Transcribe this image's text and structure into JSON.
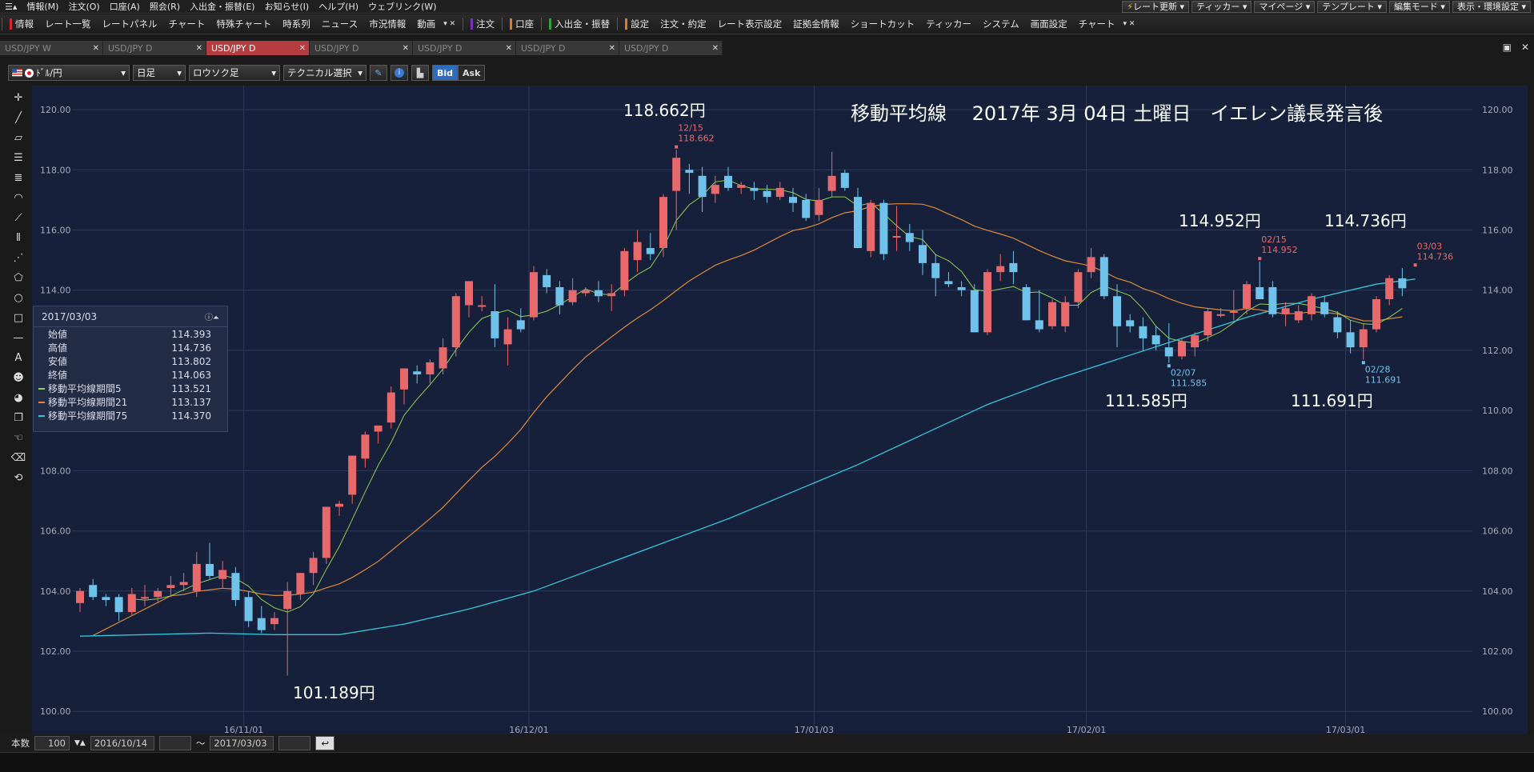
{
  "menubar": {
    "items": [
      "情報(M)",
      "注文(O)",
      "口座(A)",
      "照会(R)",
      "入出金・振替(E)",
      "お知らせ(I)",
      "ヘルプ(H)",
      "ウェブリンク(W)"
    ],
    "right_buttons": [
      "レート更新",
      "ティッカー",
      "マイページ",
      "テンプレート",
      "編集モード",
      "表示・環境設定"
    ]
  },
  "toolbar": {
    "items": [
      {
        "label": "情報",
        "color": "#d9252a"
      },
      {
        "label": "レート一覧"
      },
      {
        "label": "レートパネル"
      },
      {
        "label": "チャート"
      },
      {
        "label": "特殊チャート"
      },
      {
        "label": "時系列"
      },
      {
        "label": "ニュース"
      },
      {
        "label": "市況情報"
      },
      {
        "label": "動画"
      },
      {
        "label": "注文",
        "color": "#7b2fbe"
      },
      {
        "label": "口座",
        "color": "#e07a1f"
      },
      {
        "label": "入出金・振替",
        "color": "#2aa33a"
      },
      {
        "label": "設定",
        "color": "#e07a1f"
      },
      {
        "label": "注文・約定"
      },
      {
        "label": "レート表示設定"
      },
      {
        "label": "証拠金情報"
      },
      {
        "label": "ショートカット"
      },
      {
        "label": "ティッカー"
      },
      {
        "label": "システム"
      },
      {
        "label": "画面設定"
      },
      {
        "label": "チャート"
      }
    ]
  },
  "tabs": [
    {
      "label": "USD/JPY W",
      "active": false
    },
    {
      "label": "USD/JPY D",
      "active": false
    },
    {
      "label": "USD/JPY D",
      "active": true
    },
    {
      "label": "USD/JPY D",
      "active": false
    },
    {
      "label": "USD/JPY D",
      "active": false
    },
    {
      "label": "USD/JPY D",
      "active": false
    },
    {
      "label": "USD/JPY D",
      "active": false
    }
  ],
  "chart_toolbar": {
    "pair": "ﾄﾞﾙ/円",
    "timeframe": "日足",
    "chart_style": "ロウソク足",
    "technical": "テクニカル選択",
    "bid": "Bid",
    "ask": "Ask"
  },
  "infobox": {
    "date": "2017/03/03",
    "rows": [
      {
        "label": "始値",
        "value": "114.393"
      },
      {
        "label": "高値",
        "value": "114.736"
      },
      {
        "label": "安値",
        "value": "113.802"
      },
      {
        "label": "終値",
        "value": "114.063"
      },
      {
        "label": "移動平均線期間5",
        "value": "113.521",
        "color": "#8fcf55"
      },
      {
        "label": "移動平均線期間21",
        "value": "113.137",
        "color": "#e08a3a"
      },
      {
        "label": "移動平均線期間75",
        "value": "114.370",
        "color": "#34c6d8"
      }
    ]
  },
  "annotations": {
    "title": "移動平均線　 2017年 3月 04日 土曜日　イエレン議長発言後",
    "high_dec": "118.662円",
    "low_nov": "101.189円",
    "high_feb": "114.952円",
    "low_feb07": "111.585円",
    "low_feb28": "111.691円",
    "high_mar": "114.736円",
    "mark_dec_date": "12/15",
    "mark_dec_val": "118.662",
    "mark_feb15_date": "02/15",
    "mark_feb15_val": "114.952",
    "mark_feb07_date": "02/07",
    "mark_feb07_val": "111.585",
    "mark_feb28_date": "02/28",
    "mark_feb28_val": "111.691",
    "mark_mar_date": "03/03",
    "mark_mar_val": "114.736"
  },
  "bottombar": {
    "count_label": "本数",
    "count": "100",
    "from": "2016/10/14",
    "tilde": "～",
    "to": "2017/03/03"
  },
  "colors": {
    "up": "#e8696b",
    "down": "#6fc3ea",
    "bg": "#16203a",
    "grid": "#2c3a5c",
    "ma5": "#8fcf55",
    "ma21": "#e08a3a",
    "ma75": "#34c6d8"
  },
  "chart_data": {
    "type": "candlestick",
    "ylim": [
      99.5,
      120.8
    ],
    "yticks": [
      "100.00",
      "102.00",
      "104.00",
      "106.00",
      "108.00",
      "110.00",
      "112.00",
      "114.00",
      "116.00",
      "118.00",
      "120.00"
    ],
    "xticks": [
      {
        "label": "16/11/01",
        "i": 13
      },
      {
        "label": "16/12/01",
        "i": 35
      },
      {
        "label": "17/01/03",
        "i": 57
      },
      {
        "label": "17/02/01",
        "i": 78
      },
      {
        "label": "17/03/01",
        "i": 98
      }
    ],
    "candles": [
      [
        103.6,
        104.1,
        103.3,
        104.0
      ],
      [
        104.2,
        104.4,
        103.7,
        103.8
      ],
      [
        103.8,
        103.9,
        103.5,
        103.7
      ],
      [
        103.8,
        103.9,
        103.0,
        103.3
      ],
      [
        103.3,
        104.1,
        103.2,
        103.9
      ],
      [
        103.8,
        104.2,
        103.5,
        103.8
      ],
      [
        103.8,
        104.1,
        103.6,
        104.0
      ],
      [
        104.1,
        104.5,
        103.8,
        104.2
      ],
      [
        104.2,
        104.6,
        104.0,
        104.3
      ],
      [
        104.0,
        105.3,
        103.8,
        104.9
      ],
      [
        104.9,
        105.6,
        104.4,
        104.5
      ],
      [
        104.4,
        105.0,
        104.1,
        104.7
      ],
      [
        104.6,
        104.8,
        103.5,
        103.7
      ],
      [
        103.8,
        104.0,
        102.8,
        103.0
      ],
      [
        103.1,
        103.5,
        102.6,
        102.7
      ],
      [
        102.9,
        103.3,
        102.7,
        103.1
      ],
      [
        103.4,
        104.3,
        101.19,
        104.0
      ],
      [
        103.9,
        104.6,
        103.7,
        104.6
      ],
      [
        104.6,
        105.3,
        104.2,
        105.1
      ],
      [
        105.1,
        106.8,
        104.9,
        106.8
      ],
      [
        106.8,
        107.0,
        106.5,
        106.9
      ],
      [
        107.2,
        108.5,
        106.9,
        108.5
      ],
      [
        108.4,
        109.3,
        108.1,
        109.2
      ],
      [
        109.3,
        109.5,
        108.9,
        109.5
      ],
      [
        109.6,
        110.8,
        109.4,
        110.6
      ],
      [
        110.7,
        111.4,
        110.2,
        111.4
      ],
      [
        111.3,
        111.5,
        110.9,
        111.2
      ],
      [
        111.2,
        111.7,
        110.9,
        111.6
      ],
      [
        111.4,
        112.4,
        111.2,
        112.1
      ],
      [
        112.1,
        113.9,
        111.8,
        113.8
      ],
      [
        113.5,
        114.0,
        113.1,
        114.3
      ],
      [
        113.5,
        113.8,
        113.3,
        113.5
      ],
      [
        113.3,
        114.2,
        112.1,
        112.4
      ],
      [
        112.2,
        113.1,
        111.5,
        112.7
      ],
      [
        113.0,
        113.4,
        112.6,
        112.7
      ],
      [
        113.1,
        114.8,
        113.0,
        114.6
      ],
      [
        114.5,
        114.7,
        113.9,
        114.1
      ],
      [
        114.1,
        114.3,
        113.2,
        113.5
      ],
      [
        113.6,
        114.4,
        113.5,
        114.0
      ],
      [
        113.9,
        114.1,
        113.8,
        114.0
      ],
      [
        114.0,
        114.3,
        113.6,
        113.8
      ],
      [
        113.8,
        114.2,
        113.3,
        113.9
      ],
      [
        114.0,
        115.4,
        113.8,
        115.3
      ],
      [
        115.0,
        116.0,
        114.6,
        115.6
      ],
      [
        115.4,
        115.9,
        115.0,
        115.2
      ],
      [
        115.4,
        117.2,
        115.1,
        117.1
      ],
      [
        117.3,
        118.662,
        116.0,
        118.4
      ],
      [
        118.0,
        118.2,
        117.2,
        117.9
      ],
      [
        117.8,
        118.1,
        116.6,
        117.1
      ],
      [
        117.2,
        117.8,
        116.9,
        117.5
      ],
      [
        117.8,
        118.1,
        117.3,
        117.4
      ],
      [
        117.4,
        117.6,
        117.2,
        117.5
      ],
      [
        117.4,
        117.6,
        117.0,
        117.3
      ],
      [
        117.3,
        117.5,
        116.9,
        117.1
      ],
      [
        117.1,
        117.6,
        117.0,
        117.4
      ],
      [
        117.1,
        117.4,
        116.6,
        116.9
      ],
      [
        117.0,
        117.2,
        116.3,
        116.4
      ],
      [
        116.5,
        117.4,
        116.3,
        117.0
      ],
      [
        117.3,
        118.6,
        117.1,
        117.8
      ],
      [
        117.9,
        118.0,
        117.3,
        117.4
      ],
      [
        117.1,
        117.4,
        115.4,
        115.4
      ],
      [
        115.3,
        117.0,
        115.1,
        116.9
      ],
      [
        116.9,
        117.0,
        115.0,
        115.2
      ],
      [
        115.8,
        116.8,
        115.3,
        115.8
      ],
      [
        115.9,
        116.2,
        115.3,
        115.6
      ],
      [
        115.5,
        116.0,
        114.5,
        114.9
      ],
      [
        114.9,
        115.2,
        113.8,
        114.4
      ],
      [
        114.3,
        114.6,
        114.1,
        114.2
      ],
      [
        114.1,
        114.3,
        113.8,
        114.0
      ],
      [
        114.0,
        114.2,
        112.6,
        112.6
      ],
      [
        112.6,
        114.7,
        112.5,
        114.6
      ],
      [
        114.6,
        115.2,
        114.3,
        114.8
      ],
      [
        114.9,
        115.3,
        114.2,
        114.6
      ],
      [
        114.1,
        114.2,
        113.0,
        113.0
      ],
      [
        113.0,
        114.0,
        112.6,
        112.7
      ],
      [
        112.8,
        113.7,
        112.7,
        113.6
      ],
      [
        112.8,
        113.8,
        112.6,
        113.6
      ],
      [
        113.6,
        114.7,
        113.4,
        114.6
      ],
      [
        114.6,
        115.4,
        114.4,
        115.1
      ],
      [
        115.1,
        115.2,
        113.7,
        113.8
      ],
      [
        113.8,
        114.2,
        112.1,
        112.8
      ],
      [
        113.0,
        113.2,
        112.6,
        112.8
      ],
      [
        112.8,
        113.1,
        112.0,
        112.4
      ],
      [
        112.5,
        112.8,
        112.0,
        112.2
      ],
      [
        112.1,
        112.9,
        111.585,
        111.8
      ],
      [
        111.8,
        112.4,
        111.7,
        112.3
      ],
      [
        112.1,
        112.6,
        111.8,
        112.5
      ],
      [
        112.5,
        113.4,
        112.3,
        113.3
      ],
      [
        113.2,
        113.4,
        113.1,
        113.2
      ],
      [
        113.3,
        114.0,
        113.0,
        113.3
      ],
      [
        113.4,
        114.3,
        113.2,
        114.2
      ],
      [
        114.1,
        114.952,
        113.7,
        113.7
      ],
      [
        114.1,
        114.3,
        113.1,
        113.2
      ],
      [
        113.2,
        113.6,
        112.8,
        113.4
      ],
      [
        113.0,
        113.5,
        112.9,
        113.3
      ],
      [
        113.2,
        113.9,
        113.0,
        113.8
      ],
      [
        113.6,
        113.8,
        113.1,
        113.2
      ],
      [
        113.1,
        113.3,
        112.4,
        112.6
      ],
      [
        112.6,
        113.0,
        111.9,
        112.1
      ],
      [
        112.1,
        112.9,
        111.691,
        112.7
      ],
      [
        112.7,
        113.8,
        112.6,
        113.7
      ],
      [
        113.7,
        114.5,
        113.5,
        114.4
      ],
      [
        114.393,
        114.736,
        113.802,
        114.063
      ]
    ],
    "ma75_points": [
      [
        0,
        102.5
      ],
      [
        10,
        102.6
      ],
      [
        15,
        102.55
      ],
      [
        20,
        102.55
      ],
      [
        25,
        102.9
      ],
      [
        30,
        103.4
      ],
      [
        35,
        104.0
      ],
      [
        40,
        104.8
      ],
      [
        45,
        105.6
      ],
      [
        50,
        106.4
      ],
      [
        55,
        107.3
      ],
      [
        60,
        108.2
      ],
      [
        65,
        109.2
      ],
      [
        70,
        110.2
      ],
      [
        75,
        111.0
      ],
      [
        80,
        111.7
      ],
      [
        85,
        112.4
      ],
      [
        90,
        113.1
      ],
      [
        95,
        113.7
      ],
      [
        100,
        114.2
      ],
      [
        103,
        114.37
      ]
    ]
  }
}
